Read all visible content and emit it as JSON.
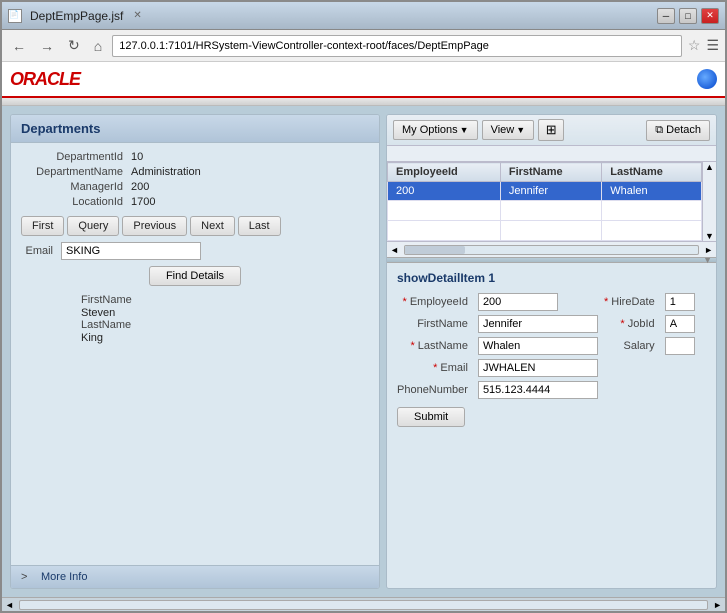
{
  "window": {
    "title": "DeptEmpPage.jsf",
    "url": "127.0.0.1:7101/HRSystem-ViewController-context-root/faces/DeptEmpPage"
  },
  "departments": {
    "header": "Departments",
    "fields": {
      "departmentId_label": "DepartmentId",
      "departmentId_value": "10",
      "departmentName_label": "DepartmentName",
      "departmentName_value": "Administration",
      "managerId_label": "ManagerId",
      "managerId_value": "200",
      "locationId_label": "LocationId",
      "locationId_value": "1700"
    },
    "buttons": {
      "first": "First",
      "query": "Query",
      "previous": "Previous",
      "next": "Next",
      "last": "Last"
    },
    "email_label": "Email",
    "email_value": "SKING",
    "find_button": "Find Details",
    "firstName_label": "FirstName",
    "firstName_value": "Steven",
    "lastName_label": "LastName",
    "lastName_value": "King",
    "more_info": "More Info",
    "collapse_arrow": ">"
  },
  "table": {
    "toolbar": {
      "my_options": "My Options",
      "view": "View",
      "detach": "Detach"
    },
    "columns": [
      "EmployeeId",
      "FirstName",
      "LastName"
    ],
    "rows": [
      {
        "employeeId": "200",
        "firstName": "Jennifer",
        "lastName": "Whalen"
      }
    ]
  },
  "detail": {
    "header": "showDetailItem 1",
    "employeeId_label": "* EmployeeId",
    "employeeId_value": "200",
    "hireDate_label": "* HireDate",
    "hireDate_value": "1",
    "firstName_label": "FirstName",
    "firstName_value": "Jennifer",
    "jobId_label": "* JobId",
    "jobId_value": "A",
    "lastName_label": "* LastName",
    "lastName_value": "Whalen",
    "salary_label": "Salary",
    "salary_value": "",
    "email_label": "* Email",
    "email_value": "JWHALEN",
    "phoneNumber_label": "PhoneNumber",
    "phoneNumber_value": "515.123.4444",
    "submit_button": "Submit"
  }
}
